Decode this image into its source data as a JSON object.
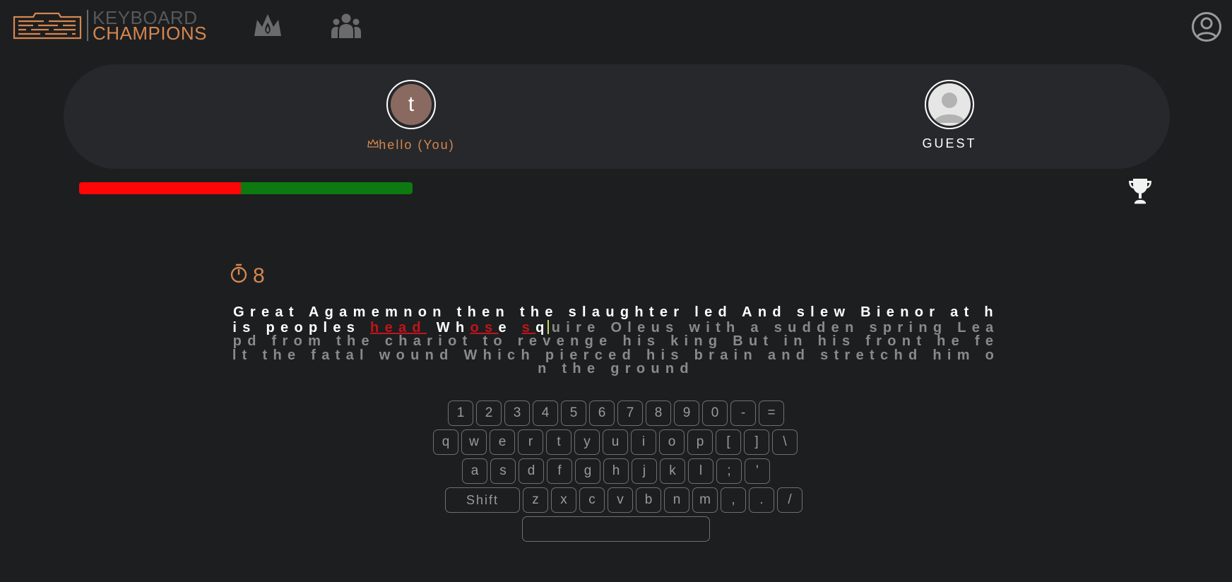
{
  "brand": {
    "line1": "KEYBOARD",
    "line2": "CHAMPIONS"
  },
  "nav": {
    "icons": [
      "crown-icon",
      "group-icon",
      "account-icon"
    ]
  },
  "players": [
    {
      "initial": "t",
      "name": "hello (You)",
      "crowned": true
    },
    {
      "name": "GUEST"
    }
  ],
  "progress": {
    "fill_fraction": 0.485,
    "fill_color": "#ff0606",
    "track_color": "#0c7a10"
  },
  "timer": {
    "value": "8"
  },
  "passage": {
    "typed_1": "Great Agamemnon then the slaughter led And slew Bienor at his peoples ",
    "wrong_1": "head",
    "typed_2": " Wh",
    "wrong_2": "os",
    "typed_3": "e ",
    "wrong_3": "s",
    "typed_4": "q",
    "rest": "uire Oleus with a sudden spring Leapd from the chariot to revenge his king But in his front he felt the fatal wound Which pierced his brain and stretchd him on the ground"
  },
  "keyboard": {
    "row1": [
      "1",
      "2",
      "3",
      "4",
      "5",
      "6",
      "7",
      "8",
      "9",
      "0",
      "-",
      "="
    ],
    "row2": [
      "q",
      "w",
      "e",
      "r",
      "t",
      "y",
      "u",
      "i",
      "o",
      "p",
      "[",
      "]",
      "\\"
    ],
    "row3": [
      "a",
      "s",
      "d",
      "f",
      "g",
      "h",
      "j",
      "k",
      "l",
      ";",
      "'"
    ],
    "row4_shift": "Shift",
    "row4": [
      "z",
      "x",
      "c",
      "v",
      "b",
      "n",
      "m",
      ",",
      ".",
      "/"
    ]
  },
  "colors": {
    "accent": "#d4874f",
    "error": "#c2141b",
    "background": "#1d1e20"
  }
}
